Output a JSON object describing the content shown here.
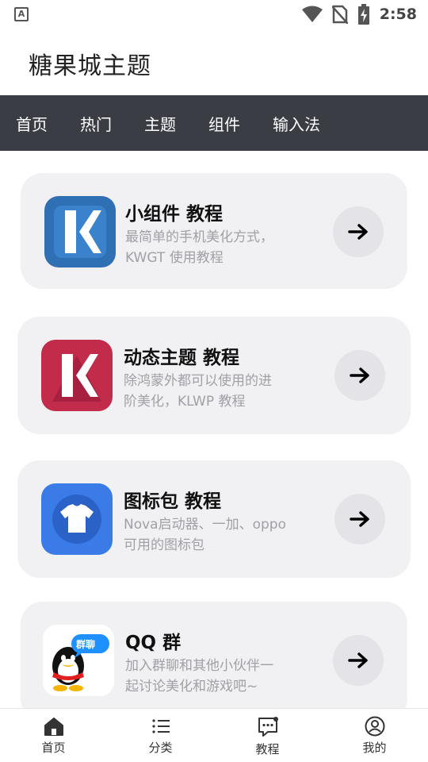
{
  "status_bar": {
    "time": "2:58",
    "notification_letter": "A"
  },
  "app": {
    "title": "糖果城主题"
  },
  "tabs": [
    {
      "label": "首页"
    },
    {
      "label": "热门"
    },
    {
      "label": "主题"
    },
    {
      "label": "组件"
    },
    {
      "label": "输入法"
    }
  ],
  "cards": [
    {
      "title": "小组件 教程",
      "desc_line1": "最简单的手机美化方式，",
      "desc_line2": "KWGT 使用教程",
      "icon": "kwgt-icon",
      "icon_color": "#2f6fb3"
    },
    {
      "title": "动态主题 教程",
      "desc_line1": "除鸿蒙外都可以使用的进",
      "desc_line2": "阶美化，KLWP 教程",
      "icon": "klwp-icon",
      "icon_color": "#c22b4a"
    },
    {
      "title": "图标包 教程",
      "desc_line1": "Nova启动器、一加、oppo",
      "desc_line2": "可用的图标包",
      "icon": "tshirt-icon",
      "icon_color": "#3a7be8"
    },
    {
      "title": "QQ 群",
      "desc_line1": "加入群聊和其他小伙伴一",
      "desc_line2": "起讨论美化和游戏吧~",
      "icon": "qq-penguin-icon",
      "badge": "群聊",
      "icon_color": "#1e90ff"
    }
  ],
  "bottom_nav": [
    {
      "label": "首页",
      "icon": "home-icon"
    },
    {
      "label": "分类",
      "icon": "list-icon"
    },
    {
      "label": "教程",
      "icon": "chat-icon"
    },
    {
      "label": "我的",
      "icon": "profile-icon"
    }
  ]
}
